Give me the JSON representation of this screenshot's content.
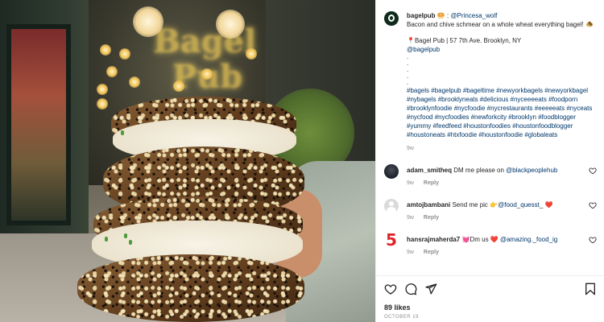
{
  "post": {
    "username": "bagelpub",
    "username_emoji": "🥯",
    "credit_prefix": " : ",
    "credit_handle": "@Princesa_wolf",
    "caption_line1": "Bacon and chive schmear on a whole wheat everything bagel!",
    "caption_line1_emoji": "🧆",
    "location_pin": "📍",
    "location": "Bagel Pub | 57 7th Ave. Brooklyn, NY",
    "mention": "@bagelpub",
    "dots": [
      ".",
      ".",
      ".",
      ".",
      "."
    ],
    "hashtags": "#bagels #bagelpub #bageltime #newyorkbagels #newyorkbagel #nybagels #brooklyneats #delicious #nyceeeeats #foodporn #brooklynfoodie #nycfoodie #nycrestaurants #eeeeeats #nyceats #nycfood #nycfoodies #newforkcity #brooklyn #foodblogger #yummy #feedfeed #houstonfoodies #houstonfoodblogger #houstoneats #htxfoodie #houstonfoodie #globaleats",
    "time": "9w"
  },
  "comments": [
    {
      "username": "adam_smitheq",
      "text": " DM me please on ",
      "mention": "@blackpeoplehub",
      "time": "9w",
      "reply_label": "Reply"
    },
    {
      "username": "amtojbambani",
      "text": " Send me pic 👉",
      "mention": "@food_quesst_",
      "text_after": " ❤️",
      "time": "9w",
      "reply_label": "Reply"
    },
    {
      "username": "hansrajmaherda7",
      "text": " 💓Dm us ❤️ ",
      "mention": "@amazing._food_ig",
      "time": "9w",
      "reply_label": "Reply"
    }
  ],
  "stats": {
    "likes": "89 likes",
    "date": "OCTOBER 19"
  },
  "photo": {
    "sign_line1": "Bagel",
    "sign_line2": "Pub"
  },
  "icons": [
    "heart-icon",
    "comment-icon",
    "share-icon",
    "bookmark-icon"
  ]
}
